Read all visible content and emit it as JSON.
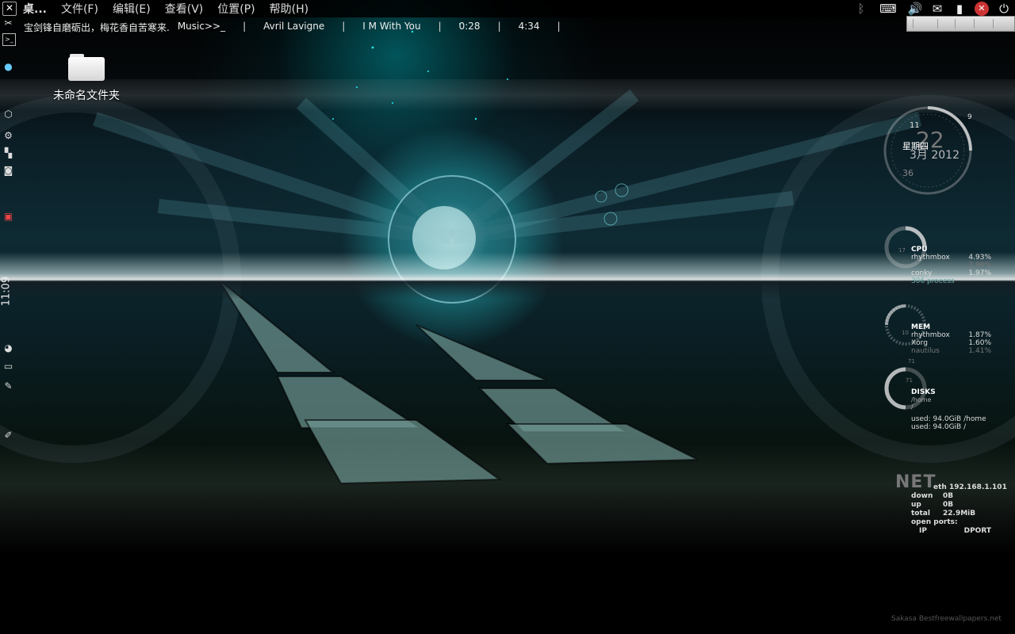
{
  "topbar": {
    "close_glyph": "✕",
    "app_name": "桌...",
    "menus": [
      "文件(F)",
      "编辑(E)",
      "查看(V)",
      "位置(P)",
      "帮助(H)"
    ],
    "tray_icons": [
      "bluetooth-icon",
      "keyboard-icon",
      "volume-icon",
      "mail-icon",
      "battery-icon",
      "notification-icon",
      "power-icon"
    ]
  },
  "ticker": {
    "quote": "宝剑锋自磨砺出，梅花香自苦寒来.",
    "music": "Music>>_",
    "artist": "Avril Lavigne",
    "title": "I M With You",
    "elapsed": "0:28",
    "total": "4:34",
    "sep": "|"
  },
  "dock": {
    "clock": "11:09"
  },
  "desktop": {
    "folder_label": "未命名文件夹"
  },
  "calendar": {
    "hour": "11",
    "day": "22",
    "weekday": "星期四",
    "month_year": "3月 2012",
    "minute": "36",
    "nine": "9"
  },
  "cpu": {
    "title": "CPU",
    "dial_labels": [
      "17",
      "13"
    ],
    "processes": [
      {
        "name": "rhythmbox",
        "value": "4.93%"
      },
      {
        "name": "",
        "value": "2.96%"
      },
      {
        "name": "conky",
        "value": "1.97%"
      }
    ],
    "footer": "306 process"
  },
  "mem": {
    "title": "MEM",
    "dial_label": "10",
    "processes": [
      {
        "name": "rhythmbox",
        "value": "1.87%"
      },
      {
        "name": "Xorg",
        "value": "1.60%"
      },
      {
        "name": "nautilus",
        "value": "1.41%"
      }
    ]
  },
  "disks": {
    "title": "DISKS",
    "dial_labels": [
      "71",
      "71"
    ],
    "mount1": "/home",
    "mount2": "/",
    "usage1": "used: 94.0GiB /home",
    "usage2": "used: 94.0GiB /"
  },
  "net": {
    "title": "NET",
    "iface": "eth 192.168.1.101",
    "down_label": "down",
    "down_value": "0B",
    "up_label": "up",
    "up_value": "0B",
    "total_label": "total",
    "total_value": "22.9MiB",
    "open_ports": "open ports:",
    "col_ip": "IP",
    "col_dport": "DPORT"
  },
  "credit": "Sakasa Bestfreewallpapers.net"
}
